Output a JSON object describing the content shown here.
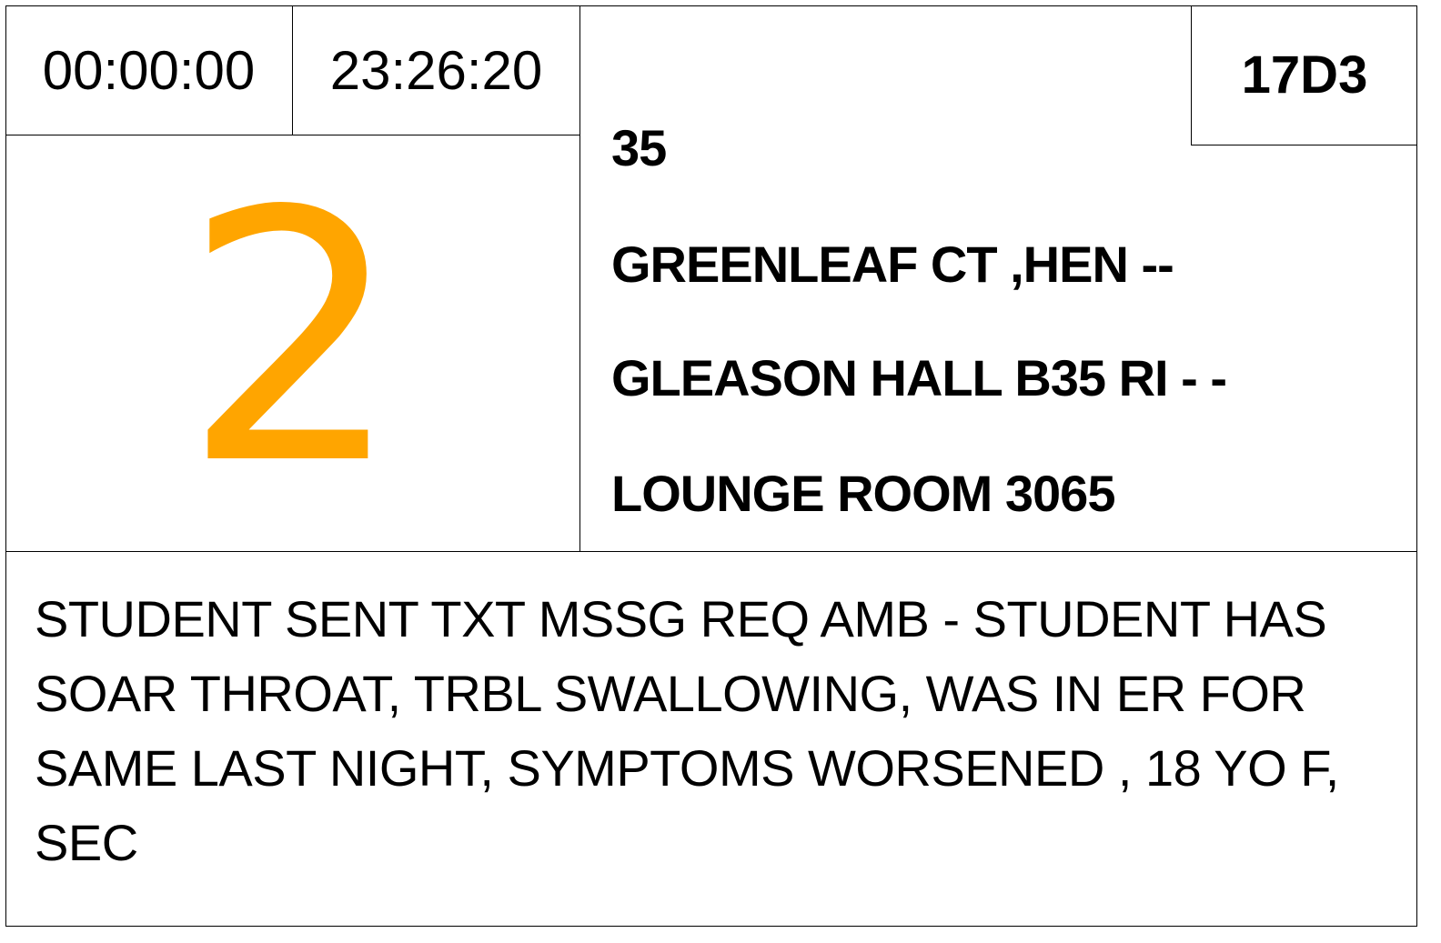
{
  "incident": {
    "elapsed_timer": "00:00:00",
    "clock_time": "23:26:20",
    "priority": "2",
    "priority_color": "#FFA500",
    "determinant_code": "17D3",
    "address_lines": [
      "35",
      "GREENLEAF CT ,HEN --",
      "GLEASON HALL B35 RI - -",
      "LOUNGE ROOM 3065"
    ],
    "notes": "STUDENT SENT TXT MSSG REQ AMB - STUDENT HAS SOAR THROAT, TRBL SWALLOWING, WAS IN ER FOR SAME LAST NIGHT, SYMPTOMS WORSENED , 18 YO F, SEC"
  }
}
